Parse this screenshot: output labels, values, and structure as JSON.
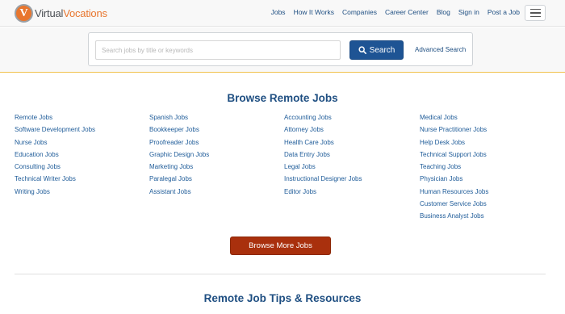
{
  "header": {
    "logo_letter": "V",
    "logo_part1": "Virtual",
    "logo_part2": "Vocations",
    "nav": [
      "Jobs",
      "How It Works",
      "Companies",
      "Career Center",
      "Blog",
      "Sign in",
      "Post a Job"
    ]
  },
  "search": {
    "placeholder": "Search jobs by title or keywords",
    "value": "",
    "button_label": "Search",
    "advanced_label": "Advanced Search"
  },
  "browse": {
    "title": "Browse Remote Jobs",
    "columns": [
      [
        "Remote Jobs",
        "Software Development Jobs",
        "Nurse Jobs",
        "Education Jobs",
        "Consulting Jobs",
        "Technical Writer Jobs",
        "Writing Jobs"
      ],
      [
        "Spanish Jobs",
        "Bookkeeper Jobs",
        "Proofreader Jobs",
        "Graphic Design Jobs",
        "Marketing Jobs",
        "Paralegal Jobs",
        "Assistant Jobs"
      ],
      [
        "Accounting Jobs",
        "Attorney Jobs",
        "Health Care Jobs",
        "Data Entry Jobs",
        "Legal Jobs",
        "Instructional Designer Jobs",
        "Editor Jobs"
      ],
      [
        "Medical Jobs",
        "Nurse Practitioner Jobs",
        "Help Desk Jobs",
        "Technical Support Jobs",
        "Teaching Jobs",
        "Physician Jobs",
        "Human Resources Jobs",
        "Customer Service Jobs",
        "Business Analyst Jobs"
      ]
    ],
    "more_button": "Browse More Jobs"
  },
  "tips": {
    "title": "Remote Job Tips & Resources"
  },
  "colors": {
    "brand_orange": "#e8762e",
    "link_blue": "#1f4f82",
    "search_button": "#1e5494",
    "more_button": "#a9300d",
    "accent_line": "#f1c24d"
  }
}
